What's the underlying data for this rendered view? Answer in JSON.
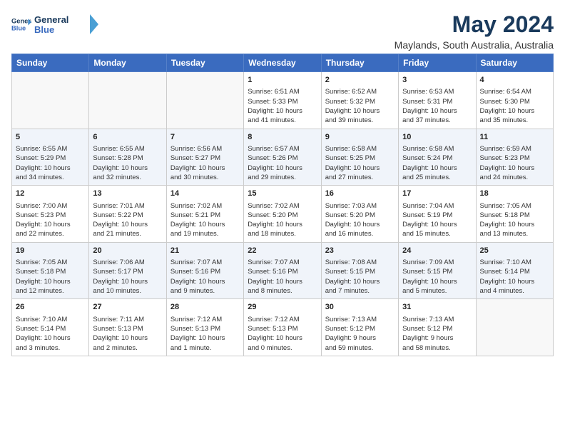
{
  "logo": {
    "line1": "General",
    "line2": "Blue"
  },
  "title": "May 2024",
  "subtitle": "Maylands, South Australia, Australia",
  "headers": [
    "Sunday",
    "Monday",
    "Tuesday",
    "Wednesday",
    "Thursday",
    "Friday",
    "Saturday"
  ],
  "weeks": [
    [
      {
        "day": "",
        "info": ""
      },
      {
        "day": "",
        "info": ""
      },
      {
        "day": "",
        "info": ""
      },
      {
        "day": "1",
        "info": "Sunrise: 6:51 AM\nSunset: 5:33 PM\nDaylight: 10 hours\nand 41 minutes."
      },
      {
        "day": "2",
        "info": "Sunrise: 6:52 AM\nSunset: 5:32 PM\nDaylight: 10 hours\nand 39 minutes."
      },
      {
        "day": "3",
        "info": "Sunrise: 6:53 AM\nSunset: 5:31 PM\nDaylight: 10 hours\nand 37 minutes."
      },
      {
        "day": "4",
        "info": "Sunrise: 6:54 AM\nSunset: 5:30 PM\nDaylight: 10 hours\nand 35 minutes."
      }
    ],
    [
      {
        "day": "5",
        "info": "Sunrise: 6:55 AM\nSunset: 5:29 PM\nDaylight: 10 hours\nand 34 minutes."
      },
      {
        "day": "6",
        "info": "Sunrise: 6:55 AM\nSunset: 5:28 PM\nDaylight: 10 hours\nand 32 minutes."
      },
      {
        "day": "7",
        "info": "Sunrise: 6:56 AM\nSunset: 5:27 PM\nDaylight: 10 hours\nand 30 minutes."
      },
      {
        "day": "8",
        "info": "Sunrise: 6:57 AM\nSunset: 5:26 PM\nDaylight: 10 hours\nand 29 minutes."
      },
      {
        "day": "9",
        "info": "Sunrise: 6:58 AM\nSunset: 5:25 PM\nDaylight: 10 hours\nand 27 minutes."
      },
      {
        "day": "10",
        "info": "Sunrise: 6:58 AM\nSunset: 5:24 PM\nDaylight: 10 hours\nand 25 minutes."
      },
      {
        "day": "11",
        "info": "Sunrise: 6:59 AM\nSunset: 5:23 PM\nDaylight: 10 hours\nand 24 minutes."
      }
    ],
    [
      {
        "day": "12",
        "info": "Sunrise: 7:00 AM\nSunset: 5:23 PM\nDaylight: 10 hours\nand 22 minutes."
      },
      {
        "day": "13",
        "info": "Sunrise: 7:01 AM\nSunset: 5:22 PM\nDaylight: 10 hours\nand 21 minutes."
      },
      {
        "day": "14",
        "info": "Sunrise: 7:02 AM\nSunset: 5:21 PM\nDaylight: 10 hours\nand 19 minutes."
      },
      {
        "day": "15",
        "info": "Sunrise: 7:02 AM\nSunset: 5:20 PM\nDaylight: 10 hours\nand 18 minutes."
      },
      {
        "day": "16",
        "info": "Sunrise: 7:03 AM\nSunset: 5:20 PM\nDaylight: 10 hours\nand 16 minutes."
      },
      {
        "day": "17",
        "info": "Sunrise: 7:04 AM\nSunset: 5:19 PM\nDaylight: 10 hours\nand 15 minutes."
      },
      {
        "day": "18",
        "info": "Sunrise: 7:05 AM\nSunset: 5:18 PM\nDaylight: 10 hours\nand 13 minutes."
      }
    ],
    [
      {
        "day": "19",
        "info": "Sunrise: 7:05 AM\nSunset: 5:18 PM\nDaylight: 10 hours\nand 12 minutes."
      },
      {
        "day": "20",
        "info": "Sunrise: 7:06 AM\nSunset: 5:17 PM\nDaylight: 10 hours\nand 10 minutes."
      },
      {
        "day": "21",
        "info": "Sunrise: 7:07 AM\nSunset: 5:16 PM\nDaylight: 10 hours\nand 9 minutes."
      },
      {
        "day": "22",
        "info": "Sunrise: 7:07 AM\nSunset: 5:16 PM\nDaylight: 10 hours\nand 8 minutes."
      },
      {
        "day": "23",
        "info": "Sunrise: 7:08 AM\nSunset: 5:15 PM\nDaylight: 10 hours\nand 7 minutes."
      },
      {
        "day": "24",
        "info": "Sunrise: 7:09 AM\nSunset: 5:15 PM\nDaylight: 10 hours\nand 5 minutes."
      },
      {
        "day": "25",
        "info": "Sunrise: 7:10 AM\nSunset: 5:14 PM\nDaylight: 10 hours\nand 4 minutes."
      }
    ],
    [
      {
        "day": "26",
        "info": "Sunrise: 7:10 AM\nSunset: 5:14 PM\nDaylight: 10 hours\nand 3 minutes."
      },
      {
        "day": "27",
        "info": "Sunrise: 7:11 AM\nSunset: 5:13 PM\nDaylight: 10 hours\nand 2 minutes."
      },
      {
        "day": "28",
        "info": "Sunrise: 7:12 AM\nSunset: 5:13 PM\nDaylight: 10 hours\nand 1 minute."
      },
      {
        "day": "29",
        "info": "Sunrise: 7:12 AM\nSunset: 5:13 PM\nDaylight: 10 hours\nand 0 minutes."
      },
      {
        "day": "30",
        "info": "Sunrise: 7:13 AM\nSunset: 5:12 PM\nDaylight: 9 hours\nand 59 minutes."
      },
      {
        "day": "31",
        "info": "Sunrise: 7:13 AM\nSunset: 5:12 PM\nDaylight: 9 hours\nand 58 minutes."
      },
      {
        "day": "",
        "info": ""
      }
    ]
  ]
}
